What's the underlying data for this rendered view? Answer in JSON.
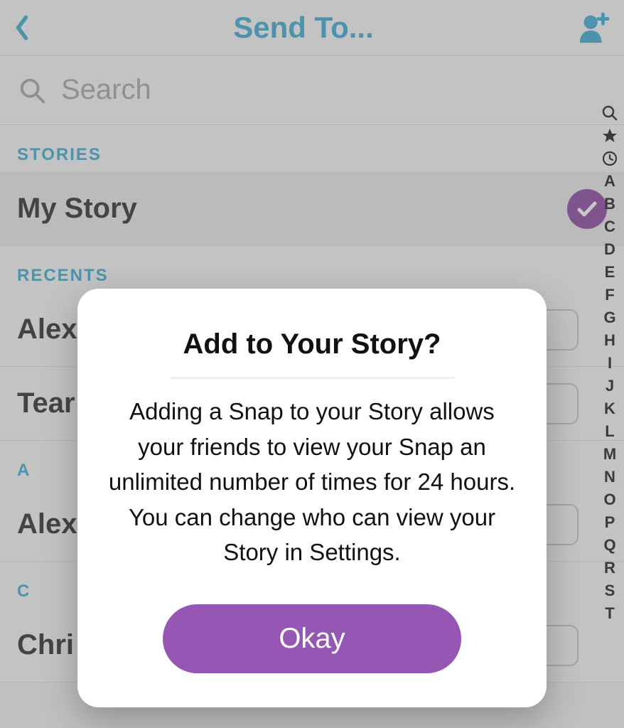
{
  "header": {
    "title": "Send To..."
  },
  "search": {
    "placeholder": "Search"
  },
  "sections": {
    "stories_label": "STORIES",
    "my_story_label": "My Story",
    "recents_label": "RECENTS",
    "letter_a": "A",
    "letter_c": "C"
  },
  "recents": [
    {
      "name": "Alex"
    },
    {
      "name": "Tear"
    }
  ],
  "contacts_a": [
    {
      "name": "Alex"
    }
  ],
  "contacts_c": [
    {
      "name": "Chri"
    }
  ],
  "az_index": [
    "A",
    "B",
    "C",
    "D",
    "E",
    "F",
    "G",
    "H",
    "I",
    "J",
    "K",
    "L",
    "M",
    "N",
    "O",
    "P",
    "Q",
    "R",
    "S",
    "T"
  ],
  "dialog": {
    "title": "Add to Your Story?",
    "body": "Adding a Snap to your Story allows your friends to view your Snap an unlimited number of times for 24 hours. You can change who can view your Story in Settings.",
    "okay": "Okay"
  }
}
